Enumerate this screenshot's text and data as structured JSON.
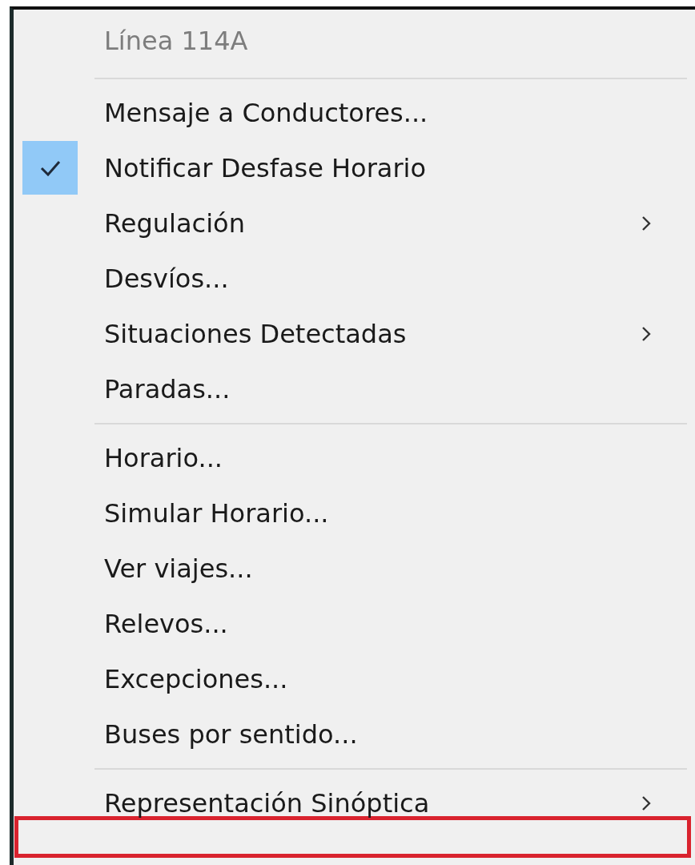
{
  "menu": {
    "items": [
      {
        "kind": "header",
        "label": "Línea 114A"
      },
      {
        "kind": "separator"
      },
      {
        "kind": "item",
        "label": "Mensaje a Conductores...",
        "checked": false,
        "submenu": false
      },
      {
        "kind": "item",
        "label": "Notificar Desfase Horario",
        "checked": true,
        "submenu": false
      },
      {
        "kind": "item",
        "label": "Regulación",
        "checked": false,
        "submenu": true
      },
      {
        "kind": "item",
        "label": "Desvíos...",
        "checked": false,
        "submenu": false
      },
      {
        "kind": "item",
        "label": "Situaciones Detectadas",
        "checked": false,
        "submenu": true
      },
      {
        "kind": "item",
        "label": "Paradas...",
        "checked": false,
        "submenu": false
      },
      {
        "kind": "separator"
      },
      {
        "kind": "item",
        "label": "Horario...",
        "checked": false,
        "submenu": false
      },
      {
        "kind": "item",
        "label": "Simular Horario...",
        "checked": false,
        "submenu": false
      },
      {
        "kind": "item",
        "label": "Ver viajes...",
        "checked": false,
        "submenu": false
      },
      {
        "kind": "item",
        "label": "Relevos...",
        "checked": false,
        "submenu": false
      },
      {
        "kind": "item",
        "label": "Excepciones...",
        "checked": false,
        "submenu": false
      },
      {
        "kind": "item",
        "label": "Buses por sentido...",
        "checked": false,
        "submenu": false
      },
      {
        "kind": "separator"
      },
      {
        "kind": "item",
        "label": "Representación Sinóptica",
        "checked": false,
        "submenu": true
      },
      {
        "kind": "highlight"
      }
    ]
  }
}
